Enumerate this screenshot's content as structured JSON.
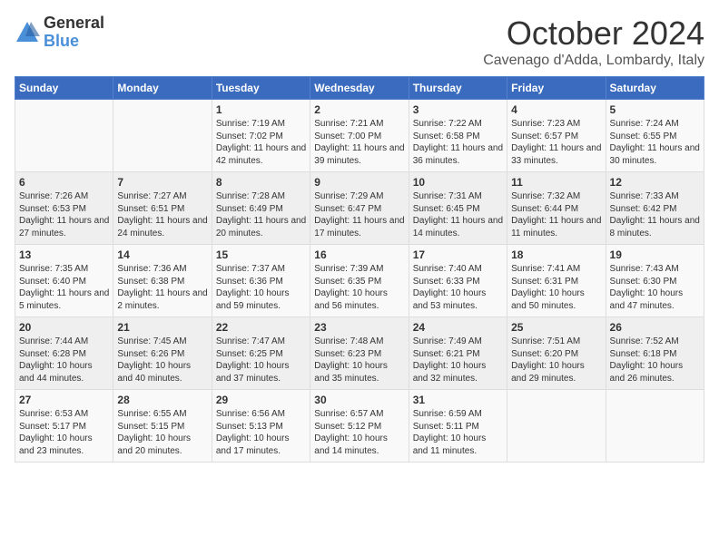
{
  "header": {
    "logo_general": "General",
    "logo_blue": "Blue",
    "month": "October 2024",
    "location": "Cavenago d'Adda, Lombardy, Italy"
  },
  "days_of_week": [
    "Sunday",
    "Monday",
    "Tuesday",
    "Wednesday",
    "Thursday",
    "Friday",
    "Saturday"
  ],
  "weeks": [
    [
      {
        "day": "",
        "text": ""
      },
      {
        "day": "",
        "text": ""
      },
      {
        "day": "1",
        "text": "Sunrise: 7:19 AM\nSunset: 7:02 PM\nDaylight: 11 hours and 42 minutes."
      },
      {
        "day": "2",
        "text": "Sunrise: 7:21 AM\nSunset: 7:00 PM\nDaylight: 11 hours and 39 minutes."
      },
      {
        "day": "3",
        "text": "Sunrise: 7:22 AM\nSunset: 6:58 PM\nDaylight: 11 hours and 36 minutes."
      },
      {
        "day": "4",
        "text": "Sunrise: 7:23 AM\nSunset: 6:57 PM\nDaylight: 11 hours and 33 minutes."
      },
      {
        "day": "5",
        "text": "Sunrise: 7:24 AM\nSunset: 6:55 PM\nDaylight: 11 hours and 30 minutes."
      }
    ],
    [
      {
        "day": "6",
        "text": "Sunrise: 7:26 AM\nSunset: 6:53 PM\nDaylight: 11 hours and 27 minutes."
      },
      {
        "day": "7",
        "text": "Sunrise: 7:27 AM\nSunset: 6:51 PM\nDaylight: 11 hours and 24 minutes."
      },
      {
        "day": "8",
        "text": "Sunrise: 7:28 AM\nSunset: 6:49 PM\nDaylight: 11 hours and 20 minutes."
      },
      {
        "day": "9",
        "text": "Sunrise: 7:29 AM\nSunset: 6:47 PM\nDaylight: 11 hours and 17 minutes."
      },
      {
        "day": "10",
        "text": "Sunrise: 7:31 AM\nSunset: 6:45 PM\nDaylight: 11 hours and 14 minutes."
      },
      {
        "day": "11",
        "text": "Sunrise: 7:32 AM\nSunset: 6:44 PM\nDaylight: 11 hours and 11 minutes."
      },
      {
        "day": "12",
        "text": "Sunrise: 7:33 AM\nSunset: 6:42 PM\nDaylight: 11 hours and 8 minutes."
      }
    ],
    [
      {
        "day": "13",
        "text": "Sunrise: 7:35 AM\nSunset: 6:40 PM\nDaylight: 11 hours and 5 minutes."
      },
      {
        "day": "14",
        "text": "Sunrise: 7:36 AM\nSunset: 6:38 PM\nDaylight: 11 hours and 2 minutes."
      },
      {
        "day": "15",
        "text": "Sunrise: 7:37 AM\nSunset: 6:36 PM\nDaylight: 10 hours and 59 minutes."
      },
      {
        "day": "16",
        "text": "Sunrise: 7:39 AM\nSunset: 6:35 PM\nDaylight: 10 hours and 56 minutes."
      },
      {
        "day": "17",
        "text": "Sunrise: 7:40 AM\nSunset: 6:33 PM\nDaylight: 10 hours and 53 minutes."
      },
      {
        "day": "18",
        "text": "Sunrise: 7:41 AM\nSunset: 6:31 PM\nDaylight: 10 hours and 50 minutes."
      },
      {
        "day": "19",
        "text": "Sunrise: 7:43 AM\nSunset: 6:30 PM\nDaylight: 10 hours and 47 minutes."
      }
    ],
    [
      {
        "day": "20",
        "text": "Sunrise: 7:44 AM\nSunset: 6:28 PM\nDaylight: 10 hours and 44 minutes."
      },
      {
        "day": "21",
        "text": "Sunrise: 7:45 AM\nSunset: 6:26 PM\nDaylight: 10 hours and 40 minutes."
      },
      {
        "day": "22",
        "text": "Sunrise: 7:47 AM\nSunset: 6:25 PM\nDaylight: 10 hours and 37 minutes."
      },
      {
        "day": "23",
        "text": "Sunrise: 7:48 AM\nSunset: 6:23 PM\nDaylight: 10 hours and 35 minutes."
      },
      {
        "day": "24",
        "text": "Sunrise: 7:49 AM\nSunset: 6:21 PM\nDaylight: 10 hours and 32 minutes."
      },
      {
        "day": "25",
        "text": "Sunrise: 7:51 AM\nSunset: 6:20 PM\nDaylight: 10 hours and 29 minutes."
      },
      {
        "day": "26",
        "text": "Sunrise: 7:52 AM\nSunset: 6:18 PM\nDaylight: 10 hours and 26 minutes."
      }
    ],
    [
      {
        "day": "27",
        "text": "Sunrise: 6:53 AM\nSunset: 5:17 PM\nDaylight: 10 hours and 23 minutes."
      },
      {
        "day": "28",
        "text": "Sunrise: 6:55 AM\nSunset: 5:15 PM\nDaylight: 10 hours and 20 minutes."
      },
      {
        "day": "29",
        "text": "Sunrise: 6:56 AM\nSunset: 5:13 PM\nDaylight: 10 hours and 17 minutes."
      },
      {
        "day": "30",
        "text": "Sunrise: 6:57 AM\nSunset: 5:12 PM\nDaylight: 10 hours and 14 minutes."
      },
      {
        "day": "31",
        "text": "Sunrise: 6:59 AM\nSunset: 5:11 PM\nDaylight: 10 hours and 11 minutes."
      },
      {
        "day": "",
        "text": ""
      },
      {
        "day": "",
        "text": ""
      }
    ]
  ]
}
